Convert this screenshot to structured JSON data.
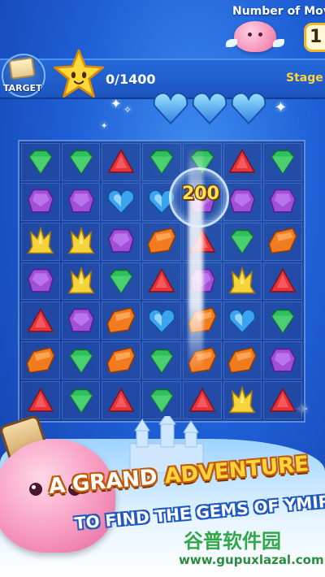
{
  "hud": {
    "moves_label": "Number of Mov",
    "moves_value": "1",
    "target_label": "TARGET",
    "score_text": "0/1400",
    "stage_label": "Stage :"
  },
  "combo": {
    "popup_score": "200"
  },
  "board": {
    "rows": [
      [
        "green",
        "green",
        "red",
        "green",
        "green",
        "red",
        "green"
      ],
      [
        "purple",
        "purple",
        "blue-heart",
        "blue-heart",
        "purple",
        "purple",
        "purple"
      ],
      [
        "yellow",
        "yellow",
        "purple",
        "orange",
        "red",
        "green",
        "orange"
      ],
      [
        "purple",
        "yellow",
        "green",
        "red",
        "purple",
        "yellow",
        "red"
      ],
      [
        "red",
        "purple",
        "orange",
        "blue-heart",
        "orange",
        "blue-heart",
        "green"
      ],
      [
        "orange",
        "green",
        "orange",
        "green",
        "orange",
        "orange",
        "purple"
      ],
      [
        "red",
        "green",
        "red",
        "green",
        "red",
        "yellow",
        "red"
      ]
    ]
  },
  "colors": {
    "background": "#1e5fd6",
    "gem_green": "#2fbf5b",
    "gem_red": "#e8333a",
    "gem_purple": "#a24fd8",
    "gem_orange": "#f27a1f",
    "gem_yellow": "#f5d43a",
    "gem_blue": "#3aa4f0",
    "popup": "#ffe25a"
  },
  "promo": {
    "line1_part1": "A GRAND ",
    "line1_part2": "ADVENTURE",
    "line2": "TO FIND THE GEMS OF YMIR"
  },
  "watermark": {
    "cn": "谷普软件园",
    "url": "www.gupuxlazal.com"
  }
}
